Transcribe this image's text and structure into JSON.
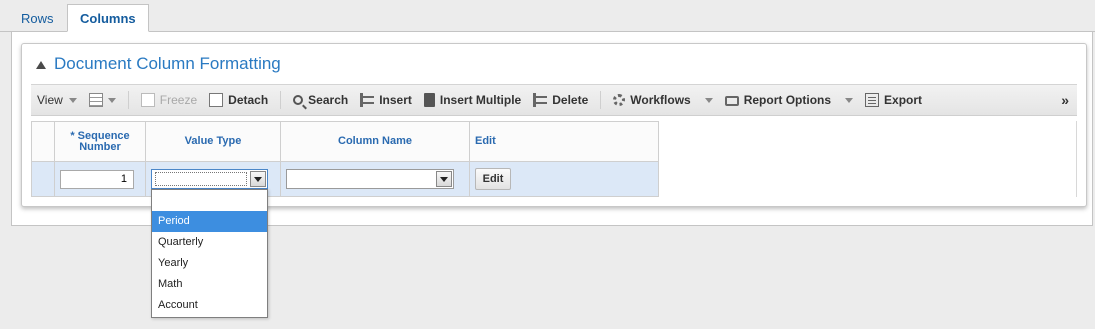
{
  "tabs": [
    {
      "label": "Rows"
    },
    {
      "label": "Columns"
    }
  ],
  "panel": {
    "title": "Document Column Formatting"
  },
  "toolbar": {
    "view": "View",
    "freeze": "Freeze",
    "detach": "Detach",
    "search": "Search",
    "insert": "Insert",
    "insert_multiple": "Insert Multiple",
    "delete": "Delete",
    "workflows": "Workflows",
    "report_options": "Report Options",
    "export": "Export",
    "more": "»"
  },
  "grid": {
    "headers": {
      "sequence": "* Sequence Number",
      "value_type": "Value Type",
      "column_name": "Column Name",
      "edit": "Edit"
    },
    "rows": [
      {
        "sequence_number": "1",
        "value_type": "",
        "column_name": "",
        "edit_label": "Edit"
      }
    ]
  },
  "dropdown": {
    "options": [
      "",
      "Period",
      "Quarterly",
      "Yearly",
      "Math",
      "Account"
    ],
    "highlighted": "Period"
  }
}
